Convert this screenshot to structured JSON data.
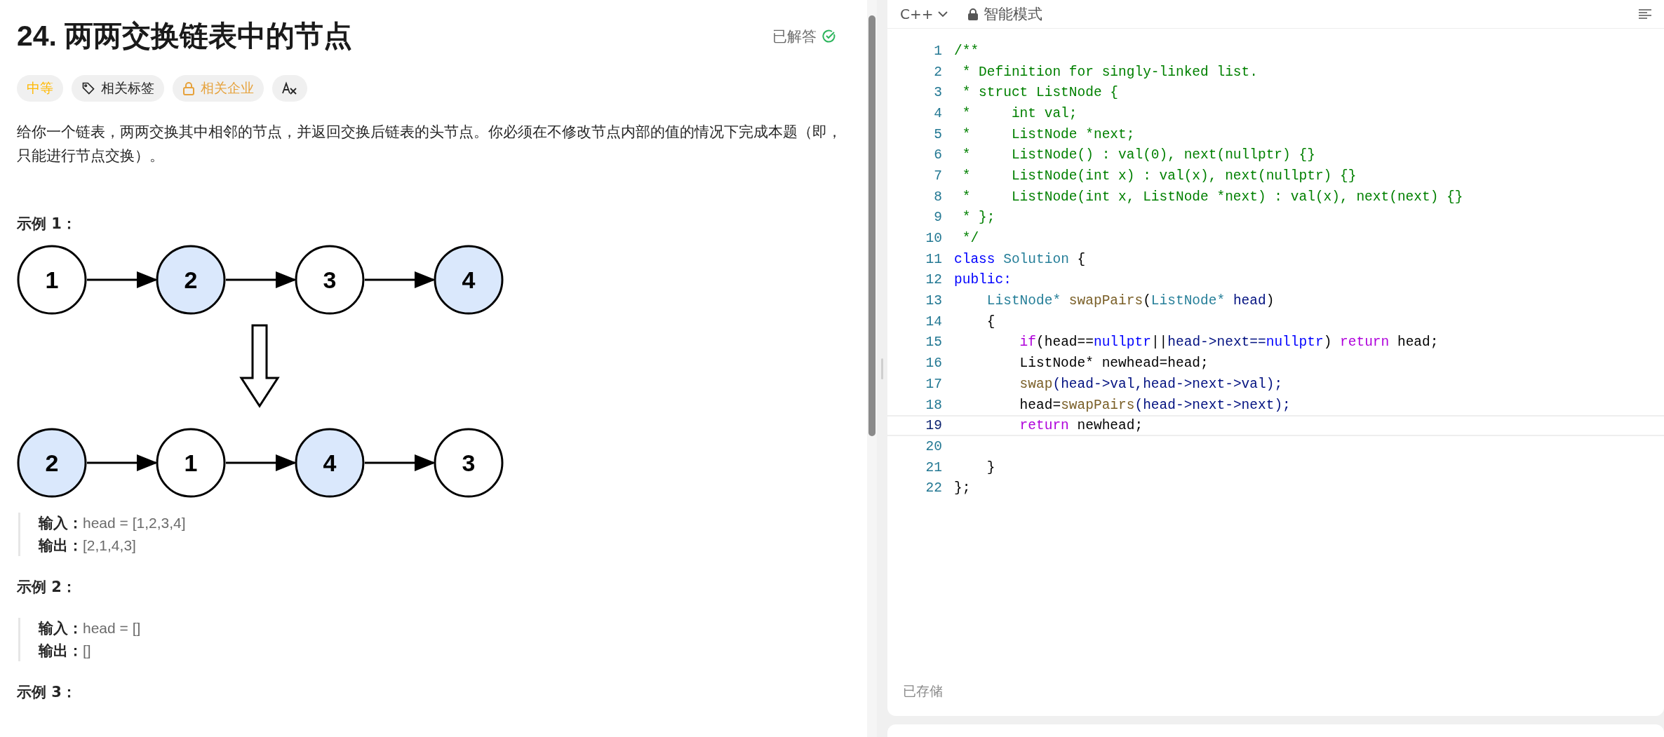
{
  "problem": {
    "title": "24. 两两交换链表中的节点",
    "status": "已解答",
    "solved": true,
    "tags": [
      {
        "kind": "difficulty",
        "label": "中等"
      },
      {
        "kind": "topics",
        "label": "相关标签"
      },
      {
        "kind": "companies",
        "label": "相关企业"
      },
      {
        "kind": "translate"
      }
    ],
    "description": "给你一个链表，两两交换其中相邻的节点，并返回交换后链表的头节点。你必须在不修改节点内部的值的情况下完成本题（即，只能进行节点交换）。",
    "examples": [
      {
        "heading": "示例 1：",
        "figure": {
          "rows": [
            [
              {
                "label": "1",
                "highlighted": false
              },
              {
                "label": "2",
                "highlighted": true
              },
              {
                "label": "3",
                "highlighted": false
              },
              {
                "label": "4",
                "highlighted": true
              }
            ],
            [
              {
                "label": "2",
                "highlighted": true
              },
              {
                "label": "1",
                "highlighted": false
              },
              {
                "label": "4",
                "highlighted": true
              },
              {
                "label": "3",
                "highlighted": false
              }
            ]
          ]
        },
        "input_label": "输入：",
        "input": "head = [1,2,3,4]",
        "output_label": "输出：",
        "output": "[2,1,4,3]"
      },
      {
        "heading": "示例 2：",
        "input_label": "输入：",
        "input": "head = []",
        "output_label": "输出：",
        "output": "[]"
      },
      {
        "heading": "示例 3："
      }
    ]
  },
  "editor": {
    "language": "C++",
    "mode": "智能模式",
    "save_status": "已存储",
    "lines": [
      {
        "number": "1",
        "current": false,
        "tokens": [
          {
            "kind": "comment",
            "text": "/**"
          }
        ]
      },
      {
        "number": "2",
        "current": false,
        "tokens": [
          {
            "kind": "comment",
            "text": " * Definition for singly-linked list."
          }
        ]
      },
      {
        "number": "3",
        "current": false,
        "tokens": [
          {
            "kind": "comment",
            "text": " * struct ListNode {"
          }
        ]
      },
      {
        "number": "4",
        "current": false,
        "tokens": [
          {
            "kind": "comment",
            "text": " *     int val;"
          }
        ]
      },
      {
        "number": "5",
        "current": false,
        "tokens": [
          {
            "kind": "comment",
            "text": " *     ListNode *next;"
          }
        ]
      },
      {
        "number": "6",
        "current": false,
        "tokens": [
          {
            "kind": "comment",
            "text": " *     ListNode() : val(0), next(nullptr) {}"
          }
        ]
      },
      {
        "number": "7",
        "current": false,
        "tokens": [
          {
            "kind": "comment",
            "text": " *     ListNode(int x) : val(x), next(nullptr) {}"
          }
        ]
      },
      {
        "number": "8",
        "current": false,
        "tokens": [
          {
            "kind": "comment",
            "text": " *     ListNode(int x, ListNode *next) : val(x), next(next) {}"
          }
        ]
      },
      {
        "number": "9",
        "current": false,
        "tokens": [
          {
            "kind": "comment",
            "text": " * };"
          }
        ]
      },
      {
        "number": "10",
        "current": false,
        "tokens": [
          {
            "kind": "comment",
            "text": " */"
          }
        ]
      },
      {
        "number": "11",
        "current": false,
        "tokens": [
          {
            "kind": "keyword",
            "text": "class"
          },
          {
            "kind": "type",
            "text": " Solution"
          },
          {
            "kind": "plain",
            "text": " {"
          }
        ]
      },
      {
        "number": "12",
        "current": false,
        "tokens": [
          {
            "kind": "keyword",
            "text": "public:"
          }
        ]
      },
      {
        "number": "13",
        "current": false,
        "tokens": [
          {
            "kind": "type",
            "text": "    ListNode*"
          },
          {
            "kind": "function",
            "text": " swapPairs"
          },
          {
            "kind": "plain",
            "text": "("
          },
          {
            "kind": "type",
            "text": "ListNode*"
          },
          {
            "kind": "variable",
            "text": " head"
          },
          {
            "kind": "plain",
            "text": ")"
          }
        ]
      },
      {
        "number": "14",
        "current": false,
        "tokens": [
          {
            "kind": "plain",
            "text": "    {"
          }
        ]
      },
      {
        "number": "15",
        "current": false,
        "tokens": [
          {
            "kind": "control",
            "text": "        if"
          },
          {
            "kind": "plain",
            "text": "(head=="
          },
          {
            "kind": "keyword",
            "text": "nullptr"
          },
          {
            "kind": "plain",
            "text": "||"
          },
          {
            "kind": "variable",
            "text": "head->next=="
          },
          {
            "kind": "keyword",
            "text": "nullptr"
          },
          {
            "kind": "plain",
            "text": ") "
          },
          {
            "kind": "control",
            "text": "return"
          },
          {
            "kind": "plain",
            "text": " head;"
          }
        ]
      },
      {
        "number": "16",
        "current": false,
        "tokens": [
          {
            "kind": "plain",
            "text": "        ListNode* newhead=head;"
          }
        ]
      },
      {
        "number": "17",
        "current": false,
        "tokens": [
          {
            "kind": "function",
            "text": "        swap"
          },
          {
            "kind": "variable",
            "text": "(head->val,head->next->val);"
          }
        ]
      },
      {
        "number": "18",
        "current": false,
        "tokens": [
          {
            "kind": "plain",
            "text": "        head="
          },
          {
            "kind": "function",
            "text": "swapPairs"
          },
          {
            "kind": "variable",
            "text": "(head->next->next);"
          }
        ]
      },
      {
        "number": "19",
        "current": true,
        "tokens": [
          {
            "kind": "control",
            "text": "        return"
          },
          {
            "kind": "plain",
            "text": " newhead;"
          }
        ]
      },
      {
        "number": "20",
        "current": false
      },
      {
        "number": "21",
        "current": false,
        "tokens": [
          {
            "kind": "plain",
            "text": "    }"
          }
        ]
      },
      {
        "number": "22",
        "current": false,
        "tokens": [
          {
            "kind": "plain",
            "text": "};"
          }
        ]
      }
    ]
  }
}
